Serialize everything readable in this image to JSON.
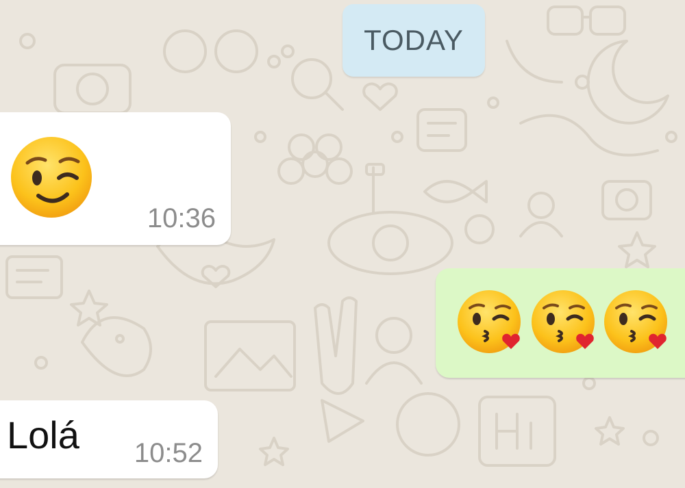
{
  "date_divider": {
    "label": "TODAY"
  },
  "messages": [
    {
      "direction": "incoming",
      "emoji": "winking-face",
      "time": "10:36"
    },
    {
      "direction": "outgoing",
      "emoji": [
        "face-blowing-a-kiss",
        "face-blowing-a-kiss",
        "face-blowing-a-kiss"
      ]
    },
    {
      "direction": "incoming",
      "text": "Lolá",
      "time": "10:52"
    }
  ],
  "colors": {
    "wallpaper": "#ebe6dd",
    "incoming_bubble": "#ffffff",
    "outgoing_bubble": "#dcf8c6",
    "date_pill": "#d4eaf4"
  }
}
